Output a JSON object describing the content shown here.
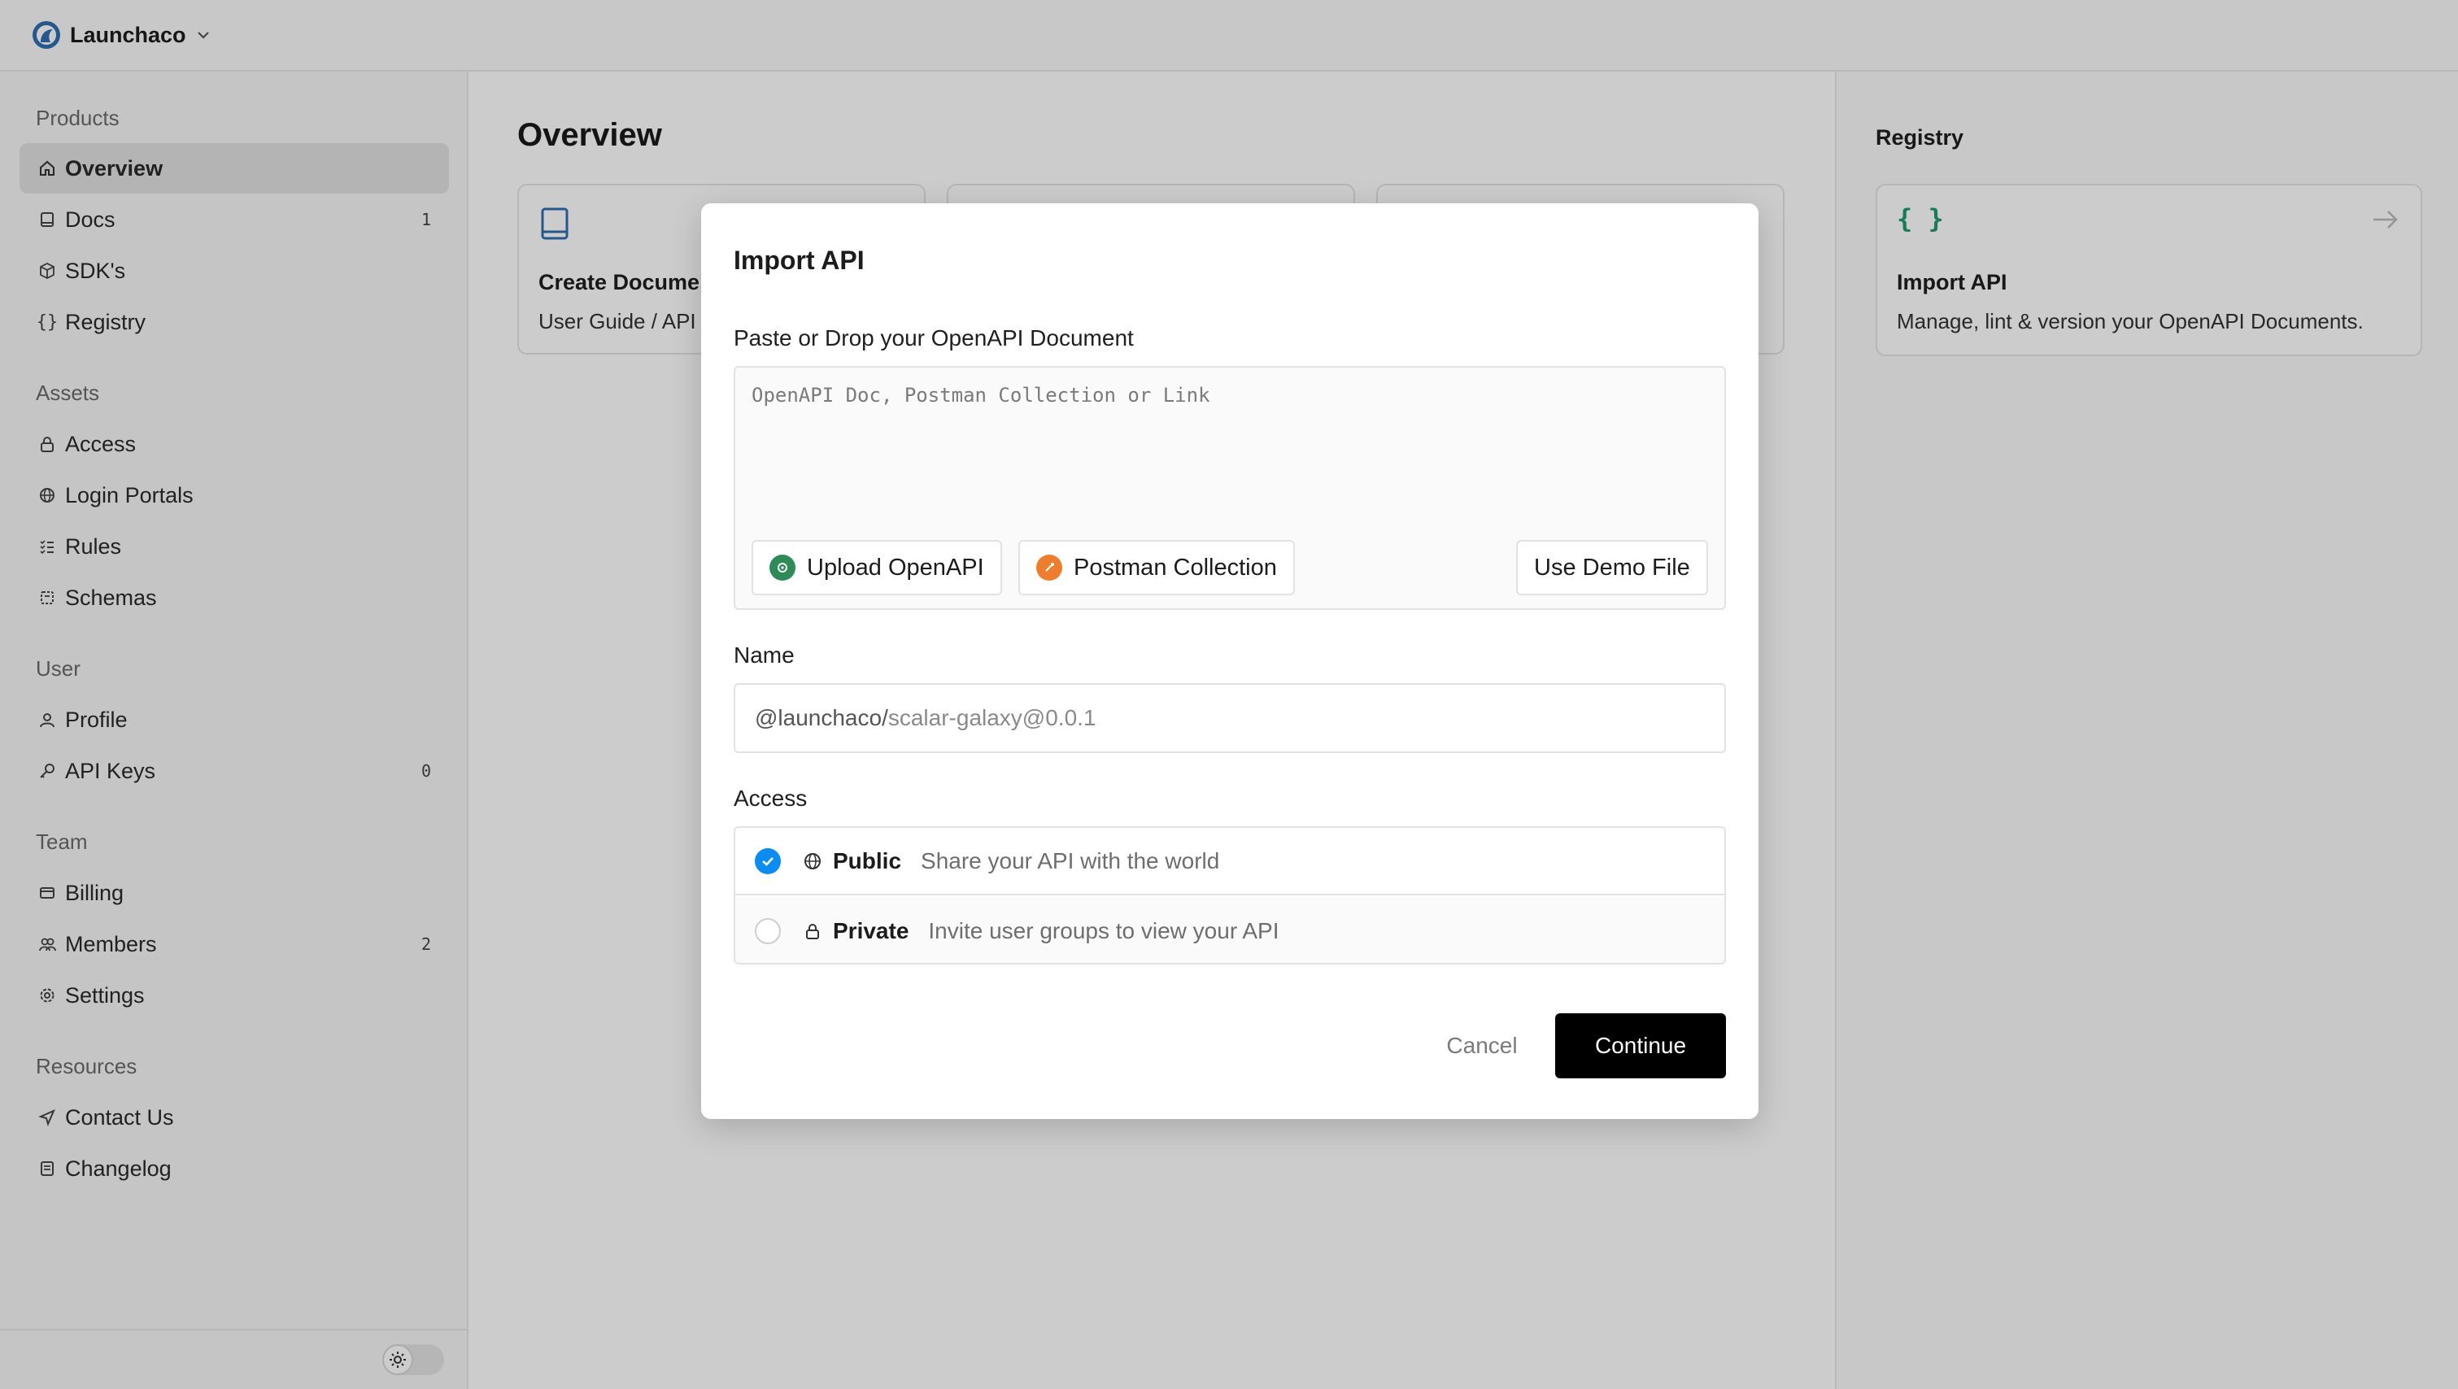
{
  "org": {
    "name": "Launchaco"
  },
  "sidebar": {
    "sections": [
      {
        "title": "Products"
      },
      {
        "title": "Assets"
      },
      {
        "title": "User"
      },
      {
        "title": "Team"
      },
      {
        "title": "Resources"
      }
    ],
    "items": [
      {
        "label": "Overview",
        "icon": "home-icon",
        "badge": ""
      },
      {
        "label": "Docs",
        "icon": "book-icon",
        "badge": "1"
      },
      {
        "label": "SDK's",
        "icon": "package-icon",
        "badge": ""
      },
      {
        "label": "Registry",
        "icon": "braces-icon",
        "badge": ""
      },
      {
        "label": "Access",
        "icon": "lock-icon",
        "badge": ""
      },
      {
        "label": "Login Portals",
        "icon": "globe-icon",
        "badge": ""
      },
      {
        "label": "Rules",
        "icon": "list-check-icon",
        "badge": ""
      },
      {
        "label": "Schemas",
        "icon": "schema-icon",
        "badge": ""
      },
      {
        "label": "Profile",
        "icon": "user-icon",
        "badge": ""
      },
      {
        "label": "API Keys",
        "icon": "key-icon",
        "badge": "0"
      },
      {
        "label": "Billing",
        "icon": "card-icon",
        "badge": ""
      },
      {
        "label": "Members",
        "icon": "users-icon",
        "badge": "2"
      },
      {
        "label": "Settings",
        "icon": "gear-icon",
        "badge": ""
      },
      {
        "label": "Contact Us",
        "icon": "send-icon",
        "badge": ""
      },
      {
        "label": "Changelog",
        "icon": "changelog-icon",
        "badge": ""
      }
    ]
  },
  "main": {
    "title": "Overview",
    "cards": [
      {
        "title": "Create Documentation",
        "subtitle": "User Guide / API Reference"
      },
      {
        "title": "",
        "subtitle": ""
      },
      {
        "title": "",
        "subtitle": ""
      }
    ]
  },
  "registry_panel": {
    "title": "Registry",
    "card": {
      "icon_text": "{ }",
      "title": "Import API",
      "subtitle": "Manage, lint & version your OpenAPI Documents."
    }
  },
  "modal": {
    "title": "Import API",
    "doc_label": "Paste or Drop your OpenAPI Document",
    "doc_placeholder": "OpenAPI Doc, Postman Collection or Link",
    "upload_label": "Upload OpenAPI",
    "postman_label": "Postman Collection",
    "demo_label": "Use Demo File",
    "name_label": "Name",
    "name_prefix": "@launchaco/",
    "name_value": "scalar-galaxy@0.0.1",
    "access_label": "Access",
    "access_options": [
      {
        "label": "Public",
        "description": "Share your API with the world",
        "selected": true
      },
      {
        "label": "Private",
        "description": "Invite user groups to view your API",
        "selected": false
      }
    ],
    "cancel_label": "Cancel",
    "continue_label": "Continue"
  },
  "colors": {
    "accent": "#0a8cf0",
    "primary_button": "#000000",
    "openapi_green": "#2e8b57",
    "postman_orange": "#ef7d2f",
    "registry_green": "#1f9d6b",
    "docs_blue": "#2f6fb0"
  }
}
